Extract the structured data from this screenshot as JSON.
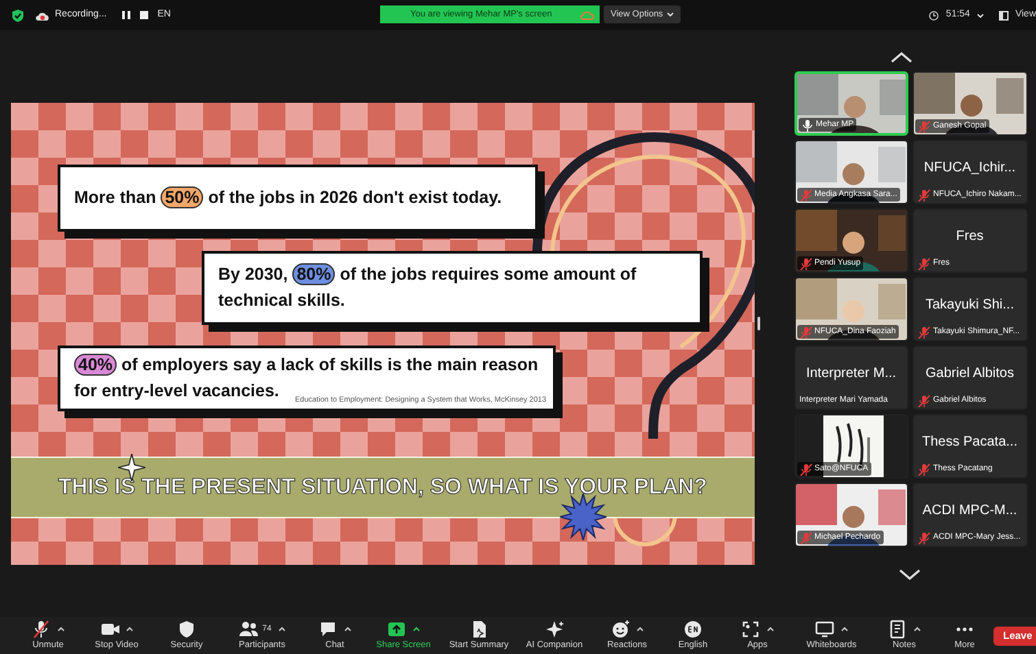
{
  "top_bar": {
    "recording_label": "Recording...",
    "language": "EN",
    "viewing_banner": "You are viewing Mehar MP's screen",
    "view_options": "View Options",
    "timer": "51:54",
    "view": "View"
  },
  "slide": {
    "statements": [
      {
        "parts": [
          {
            "text": "More than "
          },
          {
            "text": "50%",
            "color": "#f2a76a"
          },
          {
            "text": " of the jobs in 2026 don't exist today."
          }
        ]
      },
      {
        "parts": [
          {
            "text": "By 2030, "
          },
          {
            "text": "80%",
            "color": "#6e8fe0"
          },
          {
            "text": " of the jobs requires some amount of technical skills."
          }
        ]
      },
      {
        "parts": [
          {
            "text": "40%",
            "color": "#d98ad6"
          },
          {
            "text": " of employers say a lack of skills is the main reason for entry-level vacancies."
          }
        ]
      }
    ],
    "citation": "Education to Employment: Designing a System that Works, McKinsey 2013",
    "banner": "THIS IS THE PRESENT SITUATION, SO WHAT IS YOUR PLAN?"
  },
  "participants": [
    {
      "kind": "video",
      "name": "Mehar MP",
      "muted": false,
      "speaking": true
    },
    {
      "kind": "video",
      "name": "Ganesh Gopal",
      "muted": true,
      "speaking": false
    },
    {
      "kind": "video",
      "name": "Media Angkasa Sara...",
      "muted": true,
      "speaking": false
    },
    {
      "kind": "name",
      "display": "NFUCA_Ichir...",
      "name": "NFUCA_Ichiro Nakam...",
      "muted": true,
      "speaking": false
    },
    {
      "kind": "video",
      "name": "Pendi Yusup",
      "muted": true,
      "speaking": false
    },
    {
      "kind": "name",
      "display": "Fres",
      "name": "Fres",
      "muted": true,
      "speaking": false
    },
    {
      "kind": "video",
      "name": "NFUCA_Dina Faoziah",
      "muted": true,
      "speaking": false
    },
    {
      "kind": "name",
      "display": "Takayuki Shi...",
      "name": "Takayuki Shimura_NF...",
      "muted": true,
      "speaking": false
    },
    {
      "kind": "name",
      "display": "Interpreter M...",
      "name": "Interpreter Mari Yamada",
      "speaking": false
    },
    {
      "kind": "name",
      "display": "Gabriel Albitos",
      "name": "Gabriel Albitos",
      "muted": true,
      "speaking": false
    },
    {
      "kind": "video",
      "name": "Sato@NFUCA",
      "muted": true,
      "speaking": false
    },
    {
      "kind": "name",
      "display": "Thess Pacata...",
      "name": "Thess Pacatang",
      "muted": true,
      "speaking": false
    },
    {
      "kind": "video",
      "name": "Michael Pechardo",
      "muted": true,
      "speaking": false
    },
    {
      "kind": "name",
      "display": "ACDI MPC-M...",
      "name": "ACDI MPC-Mary Jess...",
      "muted": true,
      "speaking": false
    }
  ],
  "toolbar": {
    "items": [
      {
        "label": "Unmute",
        "has_menu": true,
        "accent": false
      },
      {
        "label": "Stop Video",
        "has_menu": true,
        "accent": false
      },
      {
        "label": "Security",
        "has_menu": false,
        "accent": false
      },
      {
        "label": "Participants",
        "count": "74",
        "has_menu": true,
        "accent": false
      },
      {
        "label": "Chat",
        "has_menu": true,
        "accent": false
      },
      {
        "label": "Share Screen",
        "has_menu": true,
        "accent": true
      },
      {
        "label": "Start Summary",
        "has_menu": false,
        "accent": false
      },
      {
        "label": "AI Companion",
        "has_menu": false,
        "accent": false
      },
      {
        "label": "Reactions",
        "has_menu": true,
        "accent": false
      },
      {
        "label": "English",
        "has_menu": false,
        "accent": false
      },
      {
        "label": "Apps",
        "has_menu": true,
        "accent": false
      },
      {
        "label": "Whiteboards",
        "has_menu": true,
        "accent": false
      },
      {
        "label": "Notes",
        "has_menu": true,
        "accent": false
      },
      {
        "label": "More",
        "has_menu": false,
        "accent": false
      }
    ],
    "leave": "Leave"
  }
}
